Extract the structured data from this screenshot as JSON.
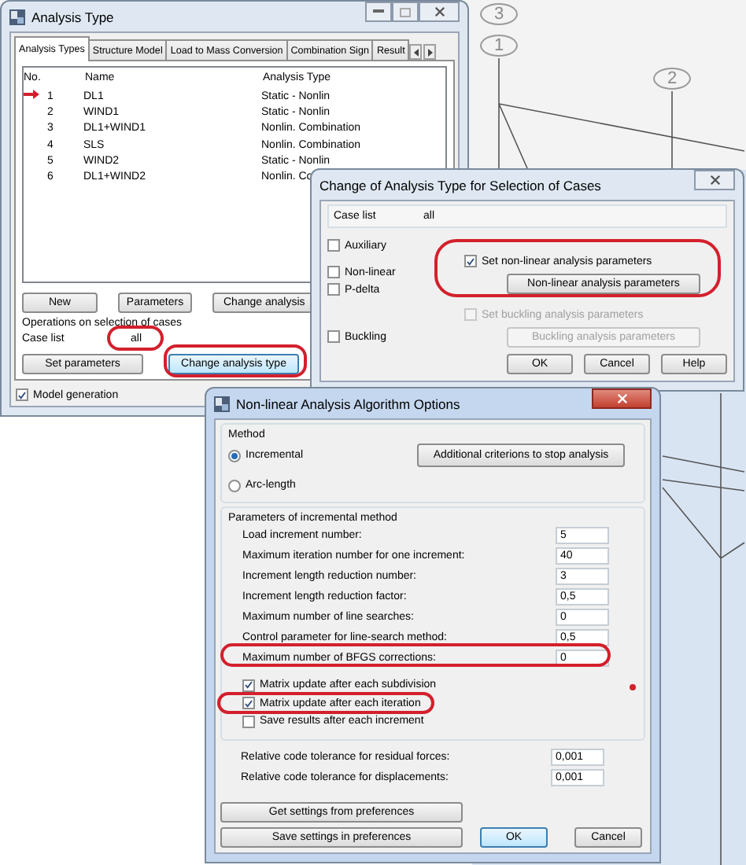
{
  "canvas": {
    "axis_labels": [
      "3",
      "1",
      "2"
    ]
  },
  "analysis_window": {
    "title": "Analysis Type",
    "tabs": [
      {
        "label": "Analysis Types",
        "selected": true
      },
      {
        "label": "Structure Model",
        "selected": false
      },
      {
        "label": "Load to Mass Conversion",
        "selected": false
      },
      {
        "label": "Combination Sign",
        "selected": false
      },
      {
        "label": "Result",
        "selected": false
      }
    ],
    "table": {
      "columns": [
        "No.",
        "Name",
        "Analysis Type"
      ],
      "rows": [
        {
          "no": "1",
          "name": "DL1",
          "type": "Static - Nonlin",
          "current": true
        },
        {
          "no": "2",
          "name": "WIND1",
          "type": "Static - Nonlin",
          "current": false
        },
        {
          "no": "3",
          "name": "DL1+WIND1",
          "type": "Nonlin. Combination",
          "current": false
        },
        {
          "no": "4",
          "name": "SLS",
          "type": "Nonlin. Combination",
          "current": false
        },
        {
          "no": "5",
          "name": "WIND2",
          "type": "Static - Nonlin",
          "current": false
        },
        {
          "no": "6",
          "name": "DL1+WIND2",
          "type": "Nonlin. Co",
          "current": false
        }
      ]
    },
    "buttons": [
      "New",
      "Parameters",
      "Change analysis"
    ],
    "operations": {
      "title": "Operations on selection of cases",
      "case_list_label": "Case list",
      "case_list_value": "all",
      "buttons": [
        "Set parameters",
        "Change analysis type"
      ]
    },
    "model_generation": {
      "label": "Model generation",
      "checked": true
    }
  },
  "change_window": {
    "title": "Change of Analysis Type for Selection of Cases",
    "case_list_label": "Case list",
    "case_list_value": "all",
    "options": [
      {
        "label": "Auxiliary",
        "checked": false
      },
      {
        "label": "Non-linear",
        "checked": false
      },
      {
        "label": "P-delta",
        "checked": false
      },
      {
        "label": "Buckling",
        "checked": false
      }
    ],
    "nonlinear": {
      "label": "Set non-linear analysis parameters",
      "checked": true,
      "disabled": false,
      "button": "Non-linear analysis parameters"
    },
    "buckling": {
      "label": "Set buckling analysis parameters",
      "checked": false,
      "disabled": true,
      "button": "Buckling analysis parameters"
    },
    "buttons": [
      "OK",
      "Cancel",
      "Help"
    ]
  },
  "nonlinear_window": {
    "title": "Non-linear Analysis Algorithm Options",
    "method": {
      "title": "Method",
      "options": [
        {
          "label": "Incremental",
          "selected": true
        },
        {
          "label": "Arc-length",
          "selected": false
        }
      ],
      "button": "Additional criterions to stop analysis"
    },
    "parameters": {
      "title": "Parameters of incremental method",
      "fields": [
        {
          "label": "Load increment number:",
          "value": "5"
        },
        {
          "label": "Maximum iteration number for one increment:",
          "value": "40"
        },
        {
          "label": "Increment length reduction number:",
          "value": "3"
        },
        {
          "label": "Increment length reduction factor:",
          "value": "0,5"
        },
        {
          "label": "Maximum number of line searches:",
          "value": "0"
        },
        {
          "label": "Control parameter for line-search method:",
          "value": "0,5"
        },
        {
          "label": "Maximum number of BFGS corrections:",
          "value": "0"
        }
      ],
      "checks": [
        {
          "label": "Matrix update after each subdivision",
          "checked": true
        },
        {
          "label": "Matrix update after each iteration",
          "checked": true
        },
        {
          "label": "Save results after each increment",
          "checked": false
        }
      ]
    },
    "tolerances": [
      {
        "label": "Relative code tolerance for residual forces:",
        "value": "0,001"
      },
      {
        "label": "Relative code tolerance for displacements:",
        "value": "0,001"
      }
    ],
    "buttons": [
      "Get settings from preferences",
      "Save settings in preferences",
      "OK",
      "Cancel"
    ]
  }
}
